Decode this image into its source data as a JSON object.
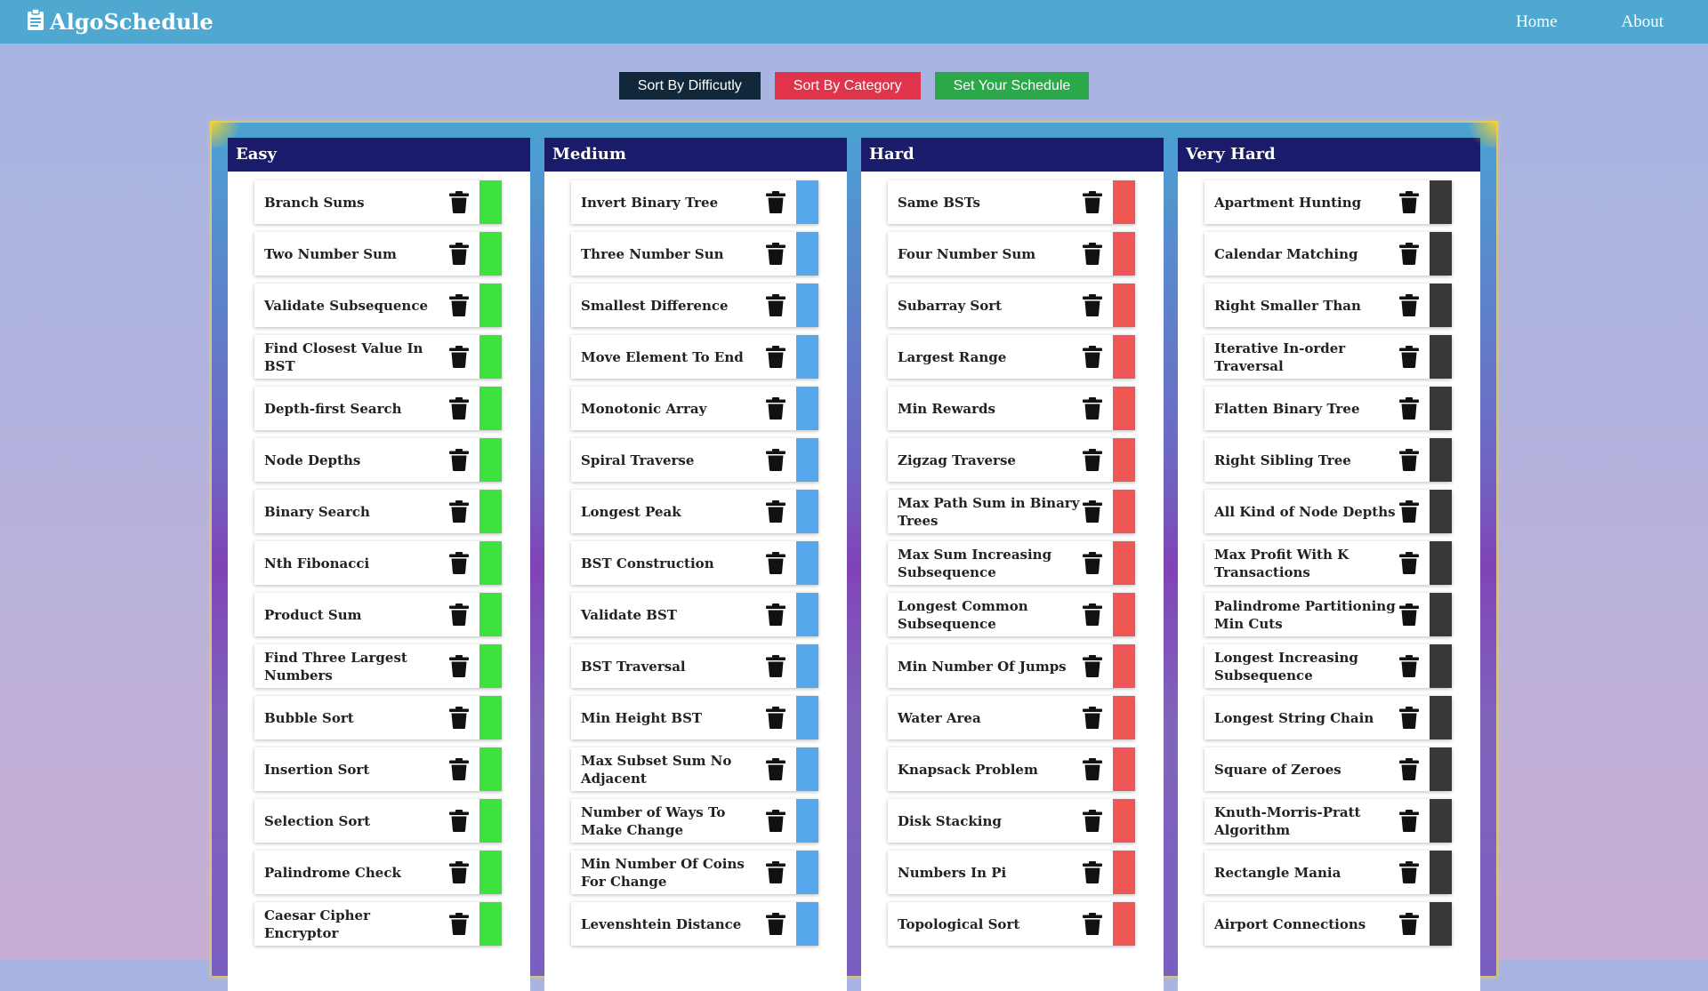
{
  "app": {
    "title": "AlgoSchedule"
  },
  "nav": {
    "links": [
      "Home",
      "About"
    ]
  },
  "sort_buttons": {
    "difficulty": "Sort By Difficutly",
    "category": "Sort By Category",
    "schedule": "Set Your Schedule"
  },
  "icons": {
    "brand": "clipboard-icon",
    "delete": "trash-icon"
  },
  "colors": {
    "easy": "#3ee23e",
    "medium": "#56a8ec",
    "hard": "#ef5757",
    "very_hard": "#383838",
    "header": "#1a1b6b",
    "navbar": "#4ea8cf"
  },
  "columns": [
    {
      "title": "Easy",
      "color": "#3ee23e",
      "items": [
        "Branch Sums",
        "Two Number Sum",
        "Validate Subsequence",
        "Find Closest Value In BST",
        "Depth-first Search",
        "Node Depths",
        "Binary Search",
        "Nth Fibonacci",
        "Product Sum",
        "Find Three Largest Numbers",
        "Bubble Sort",
        "Insertion Sort",
        "Selection Sort",
        "Palindrome Check",
        "Caesar Cipher Encryptor"
      ]
    },
    {
      "title": "Medium",
      "color": "#56a8ec",
      "items": [
        "Invert Binary Tree",
        "Three Number Sun",
        "Smallest Difference",
        "Move Element To End",
        "Monotonic Array",
        "Spiral Traverse",
        "Longest Peak",
        "BST Construction",
        "Validate BST",
        "BST Traversal",
        "Min Height BST",
        "Max Subset Sum No Adjacent",
        "Number of Ways To Make Change",
        "Min Number Of Coins For Change",
        "Levenshtein Distance"
      ]
    },
    {
      "title": "Hard",
      "color": "#ef5757",
      "items": [
        "Same BSTs",
        "Four Number Sum",
        "Subarray Sort",
        "Largest Range",
        "Min Rewards",
        "Zigzag Traverse",
        "Max Path Sum in Binary Trees",
        "Max Sum Increasing Subsequence",
        "Longest Common Subsequence",
        "Min Number Of Jumps",
        "Water Area",
        "Knapsack Problem",
        "Disk Stacking",
        "Numbers In Pi",
        "Topological Sort"
      ]
    },
    {
      "title": "Very Hard",
      "color": "#383838",
      "items": [
        "Apartment Hunting",
        "Calendar Matching",
        "Right Smaller Than",
        "Iterative In-order Traversal",
        "Flatten Binary Tree",
        "Right Sibling Tree",
        "All Kind of Node Depths",
        "Max Profit With K Transactions",
        "Palindrome Partitioning Min Cuts",
        "Longest Increasing Subsequence",
        "Longest String Chain",
        "Square of Zeroes",
        "Knuth-Morris-Pratt Algorithm",
        "Rectangle Mania",
        "Airport Connections"
      ]
    }
  ]
}
